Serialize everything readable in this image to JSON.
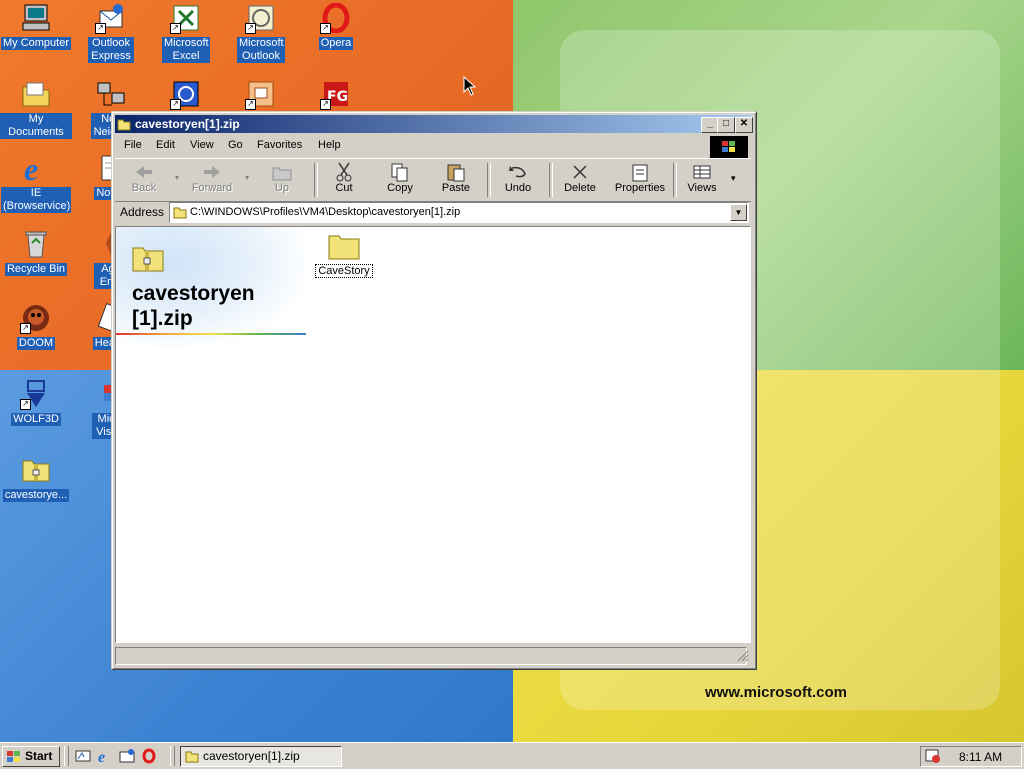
{
  "desktop": {
    "icons": [
      {
        "label": "My Computer",
        "icon": "my-computer-icon"
      },
      {
        "label": "Outlook Express",
        "icon": "outlook-express-icon"
      },
      {
        "label": "Microsoft Excel",
        "icon": "excel-icon"
      },
      {
        "label": "Microsoft Outlook",
        "icon": "outlook-icon"
      },
      {
        "label": "Opera",
        "icon": "opera-icon"
      },
      {
        "label": "My Documents",
        "icon": "my-documents-icon"
      },
      {
        "label": "Neti Neighb",
        "icon": "network-neighborhood-icon"
      },
      {
        "label": "IE (Browservice)",
        "icon": "internet-explorer-icon"
      },
      {
        "label": "Notep",
        "icon": "notepad-icon"
      },
      {
        "label": "Recycle Bin",
        "icon": "recycle-bin-icon"
      },
      {
        "label": "Age Emp",
        "icon": "age-of-empires-icon"
      },
      {
        "label": "DOOM",
        "icon": "doom-icon"
      },
      {
        "label": "Hearts",
        "icon": "hearts-icon"
      },
      {
        "label": "WOLF3D",
        "icon": "wolf3d-icon"
      },
      {
        "label": "Micro Visual",
        "icon": "visual-studio-icon"
      },
      {
        "label": "cavestorye...",
        "icon": "zip-folder-icon"
      }
    ],
    "wallpaper_text": "www.microsoft.com"
  },
  "window": {
    "title": "cavestoryen[1].zip",
    "menu": [
      "File",
      "Edit",
      "View",
      "Go",
      "Favorites",
      "Help"
    ],
    "toolbar": {
      "back": "Back",
      "forward": "Forward",
      "up": "Up",
      "cut": "Cut",
      "copy": "Copy",
      "paste": "Paste",
      "undo": "Undo",
      "delete": "Delete",
      "properties": "Properties",
      "views": "Views"
    },
    "address": {
      "label": "Address",
      "value": "C:\\WINDOWS\\Profiles\\VM4\\Desktop\\cavestoryen[1].zip"
    },
    "content": {
      "folder_title_line1": "cavestoryen",
      "folder_title_line2": "[1].zip",
      "items": [
        {
          "name": "CaveStory",
          "type": "folder"
        }
      ]
    }
  },
  "taskbar": {
    "start": "Start",
    "task_button": "cavestoryen[1].zip",
    "clock": "8:11 AM"
  },
  "colors": {
    "title_active_start": "#0a246a",
    "title_active_end": "#a6caf0",
    "chrome": "#d4d0c8",
    "desktop_label_bg": "#1f5fb4"
  }
}
